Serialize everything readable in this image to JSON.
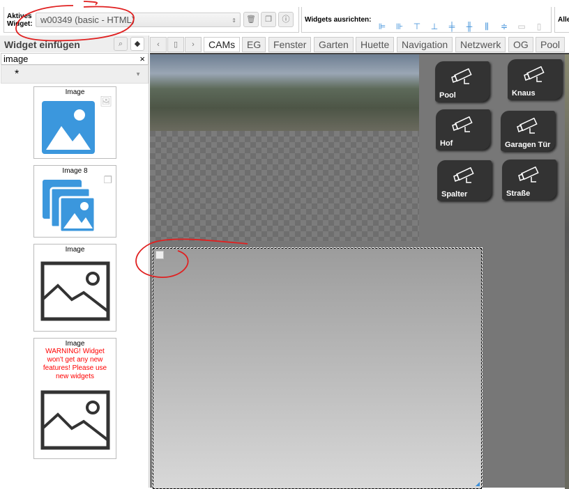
{
  "toolbar": {
    "active_widget_label": "Aktives Widget:",
    "active_widget_value": "w00349 (basic - HTML)",
    "align_label": "Widgets ausrichten:",
    "all_label": "Alle"
  },
  "sidebar": {
    "title": "Widget einfügen",
    "search_value": "image",
    "filter_value": "*",
    "cards": [
      {
        "title": "Image"
      },
      {
        "title": "Image 8"
      },
      {
        "title": "Image"
      },
      {
        "title": "Image",
        "warning": "WARNING! Widget won't get any new features! Please use new widgets"
      }
    ]
  },
  "tabs": [
    {
      "label": "CAMs",
      "active": true
    },
    {
      "label": "EG"
    },
    {
      "label": "Fenster"
    },
    {
      "label": "Garten"
    },
    {
      "label": "Huette"
    },
    {
      "label": "Navigation"
    },
    {
      "label": "Netzwerk"
    },
    {
      "label": "OG"
    },
    {
      "label": "Pool"
    }
  ],
  "cams": [
    {
      "label": "Pool"
    },
    {
      "label": "Knaus"
    },
    {
      "label": "Hof"
    },
    {
      "label": "Garagen Tür"
    },
    {
      "label": "Spalter"
    },
    {
      "label": "Straße"
    }
  ],
  "colors": {
    "accent": "#3b8ed8",
    "annotation": "#e02020",
    "warning": "#ff0000"
  }
}
